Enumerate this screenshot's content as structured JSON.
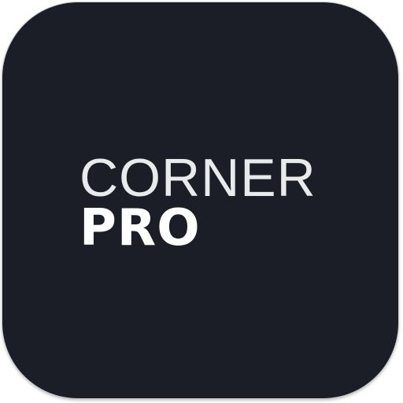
{
  "icon": {
    "background_color": "#1b1e26",
    "text_color": "#ffffff",
    "logo": {
      "line1": "CORNER",
      "line2": "PRO"
    }
  }
}
